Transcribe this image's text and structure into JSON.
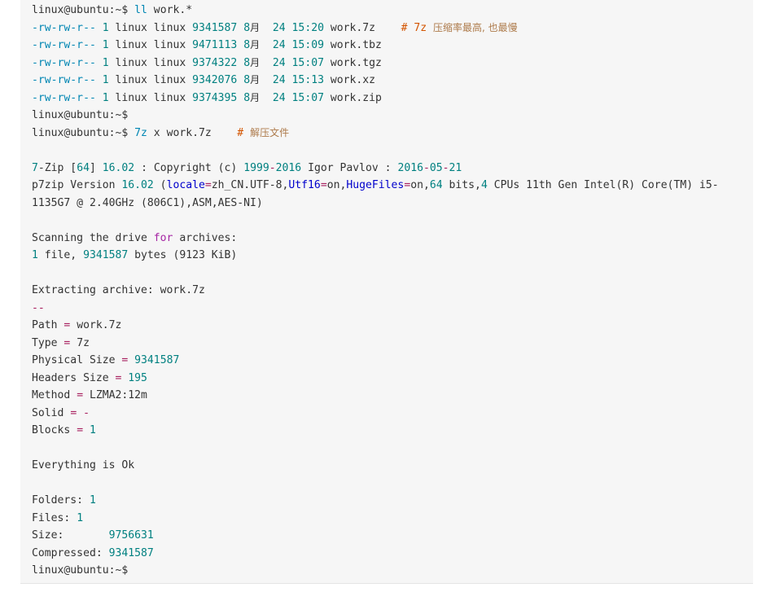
{
  "terminal": {
    "lines": [
      [
        {
          "t": "linux@ubuntu:~$ ",
          "c": "default"
        },
        {
          "t": "ll",
          "c": "cmd"
        },
        {
          "t": " work.*",
          "c": "default"
        }
      ],
      [
        {
          "t": "-rw-rw-r--",
          "c": "perm"
        },
        {
          "t": " ",
          "c": "default"
        },
        {
          "t": "1",
          "c": "num"
        },
        {
          "t": " linux linux ",
          "c": "default"
        },
        {
          "t": "9341587",
          "c": "num"
        },
        {
          "t": " ",
          "c": "default"
        },
        {
          "t": "8",
          "c": "num"
        },
        {
          "t": "月",
          "c": "date"
        },
        {
          "t": "  ",
          "c": "default"
        },
        {
          "t": "24",
          "c": "num"
        },
        {
          "t": " ",
          "c": "default"
        },
        {
          "t": "15:20",
          "c": "num"
        },
        {
          "t": " work.7z    ",
          "c": "default"
        },
        {
          "t": "# 7z ",
          "c": "comment"
        },
        {
          "t": "压缩率最高, 也最慢",
          "c": "cjk"
        }
      ],
      [
        {
          "t": "-rw-rw-r--",
          "c": "perm"
        },
        {
          "t": " ",
          "c": "default"
        },
        {
          "t": "1",
          "c": "num"
        },
        {
          "t": " linux linux ",
          "c": "default"
        },
        {
          "t": "9471113",
          "c": "num"
        },
        {
          "t": " ",
          "c": "default"
        },
        {
          "t": "8",
          "c": "num"
        },
        {
          "t": "月",
          "c": "date"
        },
        {
          "t": "  ",
          "c": "default"
        },
        {
          "t": "24",
          "c": "num"
        },
        {
          "t": " ",
          "c": "default"
        },
        {
          "t": "15:09",
          "c": "num"
        },
        {
          "t": " work.tbz",
          "c": "default"
        }
      ],
      [
        {
          "t": "-rw-rw-r--",
          "c": "perm"
        },
        {
          "t": " ",
          "c": "default"
        },
        {
          "t": "1",
          "c": "num"
        },
        {
          "t": " linux linux ",
          "c": "default"
        },
        {
          "t": "9374322",
          "c": "num"
        },
        {
          "t": " ",
          "c": "default"
        },
        {
          "t": "8",
          "c": "num"
        },
        {
          "t": "月",
          "c": "date"
        },
        {
          "t": "  ",
          "c": "default"
        },
        {
          "t": "24",
          "c": "num"
        },
        {
          "t": " ",
          "c": "default"
        },
        {
          "t": "15:07",
          "c": "num"
        },
        {
          "t": " work.tgz",
          "c": "default"
        }
      ],
      [
        {
          "t": "-rw-rw-r--",
          "c": "perm"
        },
        {
          "t": " ",
          "c": "default"
        },
        {
          "t": "1",
          "c": "num"
        },
        {
          "t": " linux linux ",
          "c": "default"
        },
        {
          "t": "9342076",
          "c": "num"
        },
        {
          "t": " ",
          "c": "default"
        },
        {
          "t": "8",
          "c": "num"
        },
        {
          "t": "月",
          "c": "date"
        },
        {
          "t": "  ",
          "c": "default"
        },
        {
          "t": "24",
          "c": "num"
        },
        {
          "t": " ",
          "c": "default"
        },
        {
          "t": "15:13",
          "c": "num"
        },
        {
          "t": " work.xz",
          "c": "default"
        }
      ],
      [
        {
          "t": "-rw-rw-r--",
          "c": "perm"
        },
        {
          "t": " ",
          "c": "default"
        },
        {
          "t": "1",
          "c": "num"
        },
        {
          "t": " linux linux ",
          "c": "default"
        },
        {
          "t": "9374395",
          "c": "num"
        },
        {
          "t": " ",
          "c": "default"
        },
        {
          "t": "8",
          "c": "num"
        },
        {
          "t": "月",
          "c": "date"
        },
        {
          "t": "  ",
          "c": "default"
        },
        {
          "t": "24",
          "c": "num"
        },
        {
          "t": " ",
          "c": "default"
        },
        {
          "t": "15:07",
          "c": "num"
        },
        {
          "t": " work.zip",
          "c": "default"
        }
      ],
      [
        {
          "t": "linux@ubuntu:~$",
          "c": "default"
        }
      ],
      [
        {
          "t": "linux@ubuntu:~$ ",
          "c": "default"
        },
        {
          "t": "7z",
          "c": "cmd"
        },
        {
          "t": " x work.7z    ",
          "c": "default"
        },
        {
          "t": "# ",
          "c": "comment"
        },
        {
          "t": "解压文件",
          "c": "cjk"
        }
      ],
      [],
      [
        {
          "t": "7",
          "c": "num"
        },
        {
          "t": "-Zip [",
          "c": "default"
        },
        {
          "t": "64",
          "c": "num"
        },
        {
          "t": "] ",
          "c": "default"
        },
        {
          "t": "16.02",
          "c": "num"
        },
        {
          "t": " : Copyright (c) ",
          "c": "default"
        },
        {
          "t": "1999",
          "c": "num"
        },
        {
          "t": "-",
          "c": "op"
        },
        {
          "t": "2016",
          "c": "num"
        },
        {
          "t": " Igor Pavlov : ",
          "c": "default"
        },
        {
          "t": "2016",
          "c": "num"
        },
        {
          "t": "-",
          "c": "op"
        },
        {
          "t": "05",
          "c": "num"
        },
        {
          "t": "-",
          "c": "op"
        },
        {
          "t": "21",
          "c": "num"
        }
      ],
      [
        {
          "t": "p7zip Version ",
          "c": "default"
        },
        {
          "t": "16.02",
          "c": "num"
        },
        {
          "t": " (",
          "c": "default"
        },
        {
          "t": "locale",
          "c": "kw2"
        },
        {
          "t": "=",
          "c": "op"
        },
        {
          "t": "zh_CN.UTF-8,",
          "c": "default"
        },
        {
          "t": "Utf16",
          "c": "kw2"
        },
        {
          "t": "=",
          "c": "op"
        },
        {
          "t": "on,",
          "c": "default"
        },
        {
          "t": "HugeFiles",
          "c": "kw2"
        },
        {
          "t": "=",
          "c": "op"
        },
        {
          "t": "on,",
          "c": "default"
        },
        {
          "t": "64",
          "c": "num"
        },
        {
          "t": " bits,",
          "c": "default"
        },
        {
          "t": "4",
          "c": "num"
        },
        {
          "t": " CPUs 11th Gen Intel(R) Core(TM) i5-",
          "c": "default"
        }
      ],
      [
        {
          "t": "1135G7 @ 2.40GHz (806C1),ASM,AES-NI)",
          "c": "default"
        }
      ],
      [],
      [
        {
          "t": "Scanning the drive ",
          "c": "default"
        },
        {
          "t": "for",
          "c": "keyword"
        },
        {
          "t": " archives:",
          "c": "default"
        }
      ],
      [
        {
          "t": "1",
          "c": "num"
        },
        {
          "t": " file, ",
          "c": "default"
        },
        {
          "t": "9341587",
          "c": "num"
        },
        {
          "t": " bytes (9123 KiB)",
          "c": "default"
        }
      ],
      [],
      [
        {
          "t": "Extracting archive: work.7z",
          "c": "default"
        }
      ],
      [
        {
          "t": "--",
          "c": "op"
        }
      ],
      [
        {
          "t": "Path ",
          "c": "default"
        },
        {
          "t": "=",
          "c": "op"
        },
        {
          "t": " work.7z",
          "c": "default"
        }
      ],
      [
        {
          "t": "Type ",
          "c": "default"
        },
        {
          "t": "=",
          "c": "op"
        },
        {
          "t": " 7z",
          "c": "default"
        }
      ],
      [
        {
          "t": "Physical Size ",
          "c": "default"
        },
        {
          "t": "=",
          "c": "op"
        },
        {
          "t": " ",
          "c": "default"
        },
        {
          "t": "9341587",
          "c": "num"
        }
      ],
      [
        {
          "t": "Headers Size ",
          "c": "default"
        },
        {
          "t": "=",
          "c": "op"
        },
        {
          "t": " ",
          "c": "default"
        },
        {
          "t": "195",
          "c": "num"
        }
      ],
      [
        {
          "t": "Method ",
          "c": "default"
        },
        {
          "t": "=",
          "c": "op"
        },
        {
          "t": " LZMA2:12m",
          "c": "default"
        }
      ],
      [
        {
          "t": "Solid ",
          "c": "default"
        },
        {
          "t": "=",
          "c": "op"
        },
        {
          "t": " ",
          "c": "default"
        },
        {
          "t": "-",
          "c": "op"
        }
      ],
      [
        {
          "t": "Blocks ",
          "c": "default"
        },
        {
          "t": "=",
          "c": "op"
        },
        {
          "t": " ",
          "c": "default"
        },
        {
          "t": "1",
          "c": "num"
        }
      ],
      [],
      [
        {
          "t": "Everything is Ok",
          "c": "default"
        }
      ],
      [],
      [
        {
          "t": "Folders: ",
          "c": "default"
        },
        {
          "t": "1",
          "c": "num"
        }
      ],
      [
        {
          "t": "Files: ",
          "c": "default"
        },
        {
          "t": "1",
          "c": "num"
        }
      ],
      [
        {
          "t": "Size:       ",
          "c": "default"
        },
        {
          "t": "9756631",
          "c": "num"
        }
      ],
      [
        {
          "t": "Compressed: ",
          "c": "default"
        },
        {
          "t": "9341587",
          "c": "num"
        }
      ],
      [
        {
          "t": "linux@ubuntu:~$",
          "c": "default"
        }
      ]
    ]
  }
}
